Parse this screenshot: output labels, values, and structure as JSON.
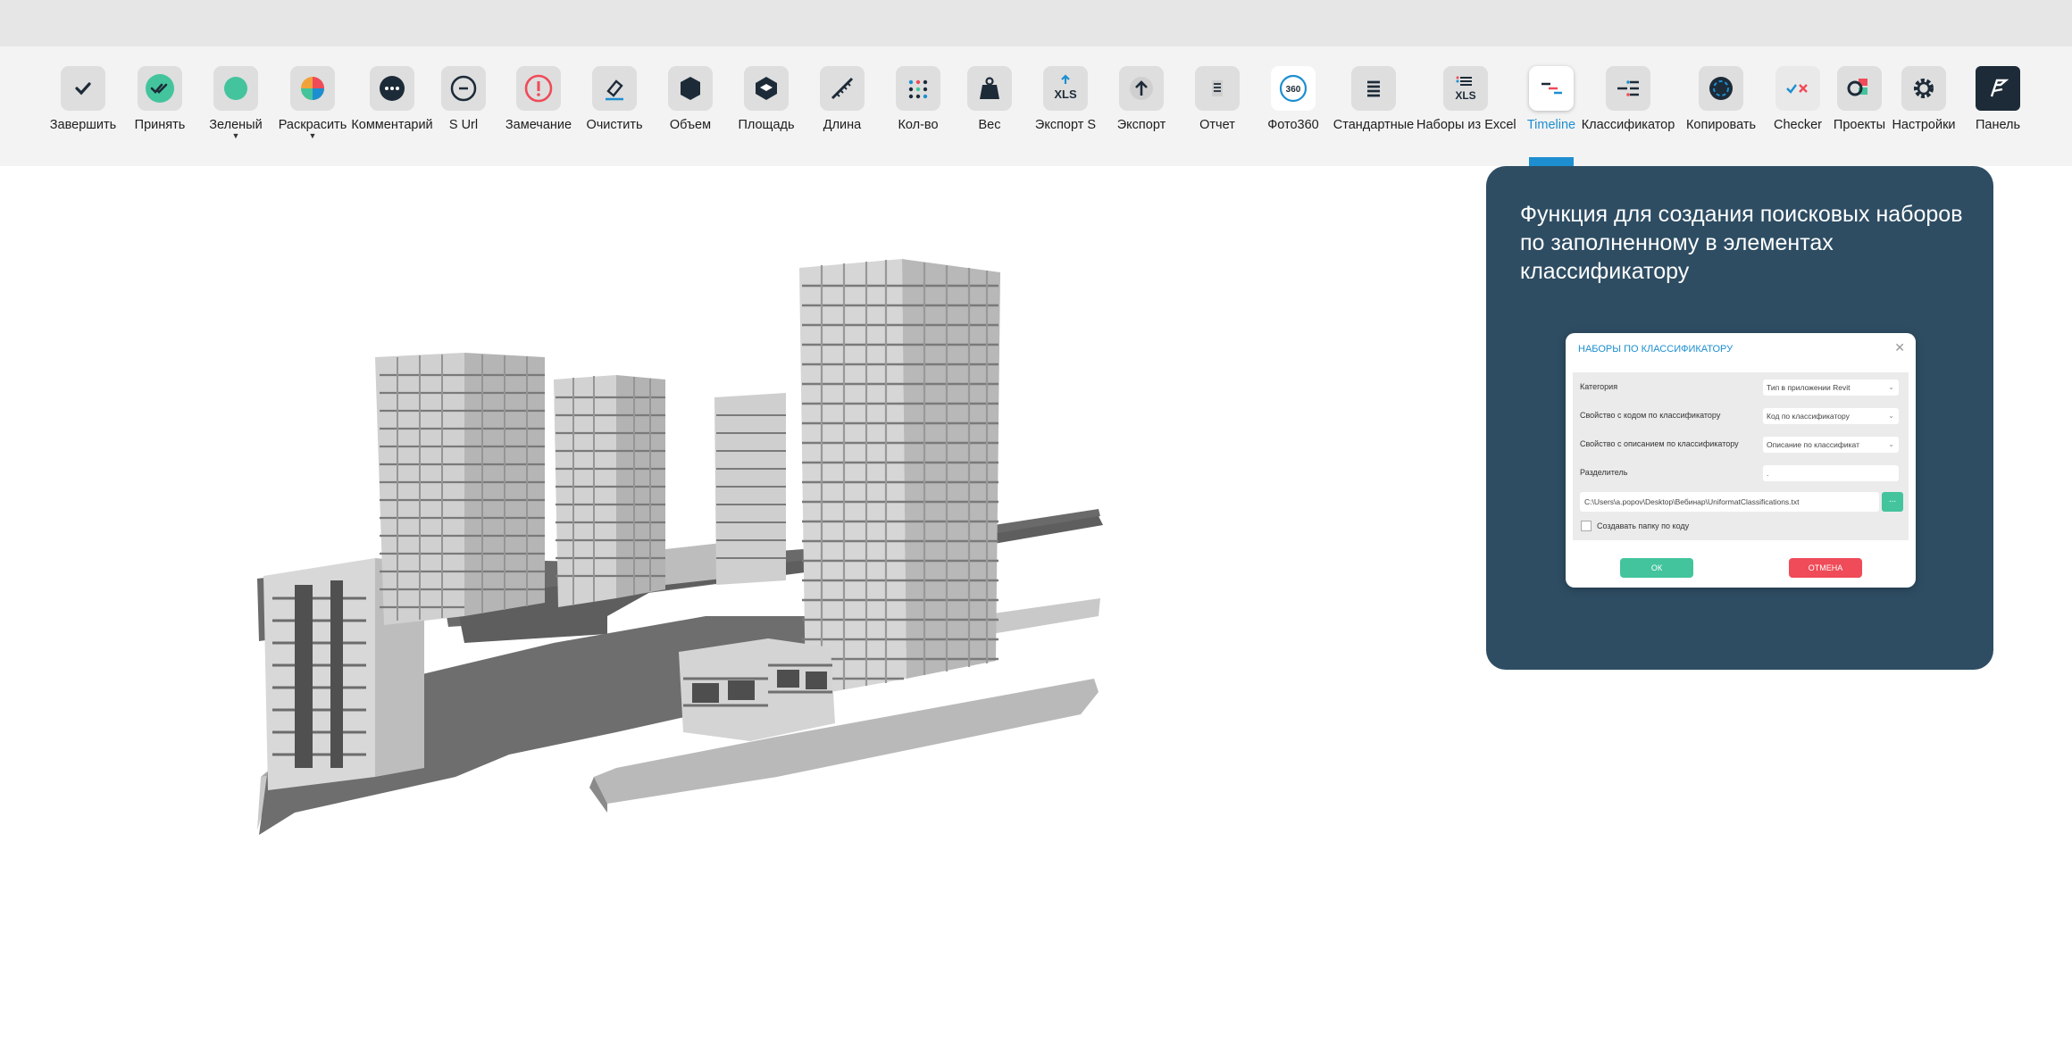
{
  "toolbar": {
    "items": [
      {
        "label": "Завершить",
        "icon": "check-icon",
        "dropdown": false
      },
      {
        "label": "Принять",
        "icon": "double-check-icon",
        "dropdown": false
      },
      {
        "label": "Зеленый",
        "icon": "green-circle-icon",
        "dropdown": true
      },
      {
        "label": "Раскрасить",
        "icon": "color-wheel-icon",
        "dropdown": true
      },
      {
        "label": "Комментарий",
        "icon": "comment-icon",
        "dropdown": false
      },
      {
        "label": "S Url",
        "icon": "link-icon",
        "dropdown": false
      },
      {
        "label": "Замечание",
        "icon": "warning-icon",
        "dropdown": false
      },
      {
        "label": "Очистить",
        "icon": "eraser-icon",
        "dropdown": false
      },
      {
        "label": "Объем",
        "icon": "volume-icon",
        "dropdown": false
      },
      {
        "label": "Площадь",
        "icon": "area-icon",
        "dropdown": false
      },
      {
        "label": "Длина",
        "icon": "ruler-icon",
        "dropdown": false
      },
      {
        "label": "Кол-во",
        "icon": "count-icon",
        "dropdown": false
      },
      {
        "label": "Вес",
        "icon": "weight-icon",
        "dropdown": false
      },
      {
        "label": "Экспорт S",
        "icon": "xls-export-icon",
        "icon_text": "XLS",
        "dropdown": false
      },
      {
        "label": "Экспорт",
        "icon": "export-icon",
        "dropdown": false
      },
      {
        "label": "Отчет",
        "icon": "report-icon",
        "dropdown": false
      },
      {
        "label": "Фото360",
        "icon": "photo360-icon",
        "icon_text": "360",
        "dropdown": false
      },
      {
        "label": "Стандартные",
        "icon": "standard-sets-icon",
        "dropdown": false
      },
      {
        "label": "Наборы из Excel",
        "icon": "excel-sets-icon",
        "icon_text": "XLS",
        "dropdown": false
      },
      {
        "label": "Timeline",
        "icon": "timeline-icon",
        "dropdown": false,
        "active": true
      },
      {
        "label": "Классификатор",
        "icon": "classifier-icon",
        "dropdown": false
      },
      {
        "label": "Копировать",
        "icon": "copy-icon",
        "dropdown": false
      },
      {
        "label": "Checker",
        "icon": "checker-icon",
        "dropdown": false
      },
      {
        "label": "Проекты",
        "icon": "projects-icon",
        "dropdown": false
      },
      {
        "label": "Настройки",
        "icon": "gear-icon",
        "dropdown": false
      },
      {
        "label": "Панель",
        "icon": "panel-logo-icon",
        "dropdown": false
      }
    ]
  },
  "info_panel": {
    "title": "Функция для создания поисковых наборов по заполненному в элементах классификатору"
  },
  "dialog": {
    "title": "НАБОРЫ ПО КЛАССИФИКАТОРУ",
    "close_icon": "close-icon",
    "rows": [
      {
        "label": "Категория",
        "value": "Тип в приложении Revit"
      },
      {
        "label": "Свойство с кодом по классификатору",
        "value": "Код по классификатору"
      },
      {
        "label": "Свойство с описанием по классификатору",
        "value": "Описание по классификат"
      },
      {
        "label": "Разделитель",
        "value": "."
      }
    ],
    "path": "C:\\Users\\a.popov\\Desktop\\Вебинар\\UniformatClassifications.txt",
    "browse_label": "...",
    "checkbox_label": "Создавать папку по коду",
    "checkbox_checked": false,
    "ok_label": "ОК",
    "cancel_label": "ОТМЕНА"
  },
  "colors": {
    "accent": "#1d8fd0",
    "panel_bg": "#2e4d63",
    "ok": "#43c49c",
    "cancel": "#ef4b58"
  }
}
